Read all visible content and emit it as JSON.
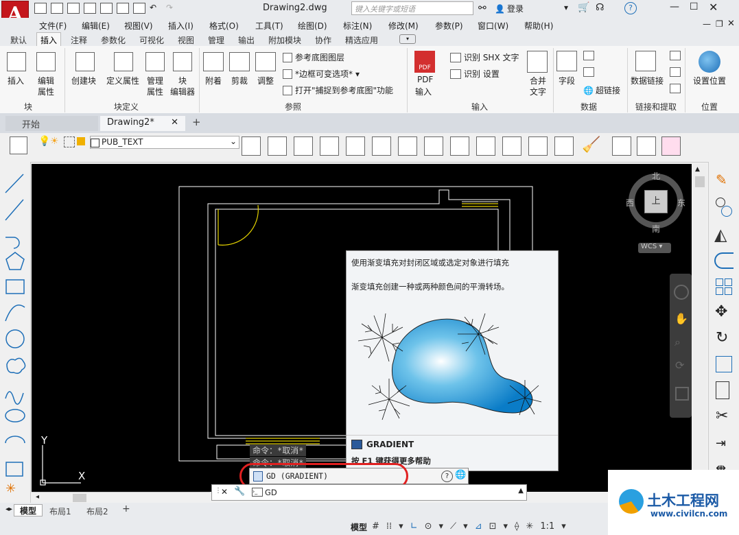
{
  "title_bar": {
    "document_title": "Drawing2.dwg",
    "search_placeholder": "键入关键字或短语",
    "login_label": "登录"
  },
  "menu_bar": [
    "文件(F)",
    "编辑(E)",
    "视图(V)",
    "插入(I)",
    "格式(O)",
    "工具(T)",
    "绘图(D)",
    "标注(N)",
    "修改(M)",
    "参数(P)",
    "窗口(W)",
    "帮助(H)"
  ],
  "ribbon_tabs": [
    "默认",
    "插入",
    "注释",
    "参数化",
    "可视化",
    "视图",
    "管理",
    "输出",
    "附加模块",
    "协作",
    "精选应用"
  ],
  "active_ribbon_tab": "插入",
  "ribbon": {
    "block": {
      "insert": "插入",
      "edit_attr_1": "编辑",
      "edit_attr_2": "属性",
      "group": "块"
    },
    "block_def": {
      "create": "创建块",
      "define_attr": "定义属性",
      "manage_1": "管理",
      "manage_2": "属性",
      "editor_1": "块",
      "editor_2": "编辑器",
      "group": "块定义"
    },
    "reference": {
      "attach": "附着",
      "clip": "剪裁",
      "adjust": "调整",
      "underlay_layers": "参考底图图层",
      "frame": "*边框可变选项*",
      "snap": "打开\"捕捉到参考底图\"功能",
      "group": "参照"
    },
    "import": {
      "pdf_1": "PDF",
      "pdf_2": "输入",
      "shx": "识别 SHX 文字",
      "recog_settings": "识别 设置",
      "merge_1": "合并",
      "merge_2": "文字",
      "group": "输入"
    },
    "data": {
      "field": "字段",
      "hyperlink": "超链接",
      "group": "数据"
    },
    "link": {
      "data_link": "数据链接",
      "group": "链接和提取"
    },
    "location": {
      "set_1": "设置位置",
      "group": "位置"
    }
  },
  "doc_tabs": {
    "start": "开始",
    "drawing": "Drawing2*"
  },
  "layer": {
    "current": "PUB_TEXT"
  },
  "viewcube": {
    "north": "北",
    "south": "南",
    "east": "东",
    "west": "西",
    "top": "上",
    "wcs": "WCS"
  },
  "ucs": {
    "x": "X",
    "y": "Y"
  },
  "tooltip": {
    "line1": "使用渐变填充对封闭区域或选定对象进行填充",
    "line2": "渐变填充创建一种或两种颜色间的平滑转场。",
    "command": "GRADIENT",
    "help": "按 F1 键获得更多帮助"
  },
  "autocomplete": {
    "entry": "GD (GRADIENT)"
  },
  "command_history": [
    "命令：*取消*",
    "命令：*取消*"
  ],
  "command_line": {
    "value": "GD"
  },
  "layout_tabs": [
    "模型",
    "布局1",
    "布局2"
  ],
  "status_bar": {
    "model": "模型",
    "scale": "1:1"
  },
  "watermark": {
    "name": "土木工程网",
    "url": "www.civilcn.com"
  },
  "colors": {
    "app_red": "#c4161c",
    "canvas": "#000000",
    "accent_blue": "#1e6fb8",
    "highlight_ring": "#e02020"
  }
}
